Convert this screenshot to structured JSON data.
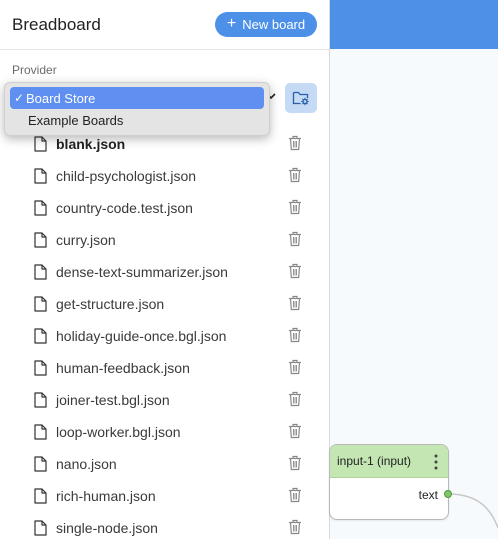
{
  "sidebar": {
    "title": "Breadboard",
    "new_board_label": "New board",
    "provider_label": "Provider",
    "provider_options": [
      {
        "label": "Board Store",
        "selected": true
      },
      {
        "label": "Example Boards",
        "selected": false
      }
    ],
    "files": [
      {
        "name": "blank.json",
        "active": true
      },
      {
        "name": "child-psychologist.json"
      },
      {
        "name": "country-code.test.json"
      },
      {
        "name": "curry.json"
      },
      {
        "name": "dense-text-summarizer.json"
      },
      {
        "name": "get-structure.json"
      },
      {
        "name": "holiday-guide-once.bgl.json"
      },
      {
        "name": "human-feedback.json"
      },
      {
        "name": "joiner-test.bgl.json"
      },
      {
        "name": "loop-worker.bgl.json"
      },
      {
        "name": "nano.json"
      },
      {
        "name": "rich-human.json"
      },
      {
        "name": "single-node.json"
      }
    ]
  },
  "node": {
    "title": "input-1 (input)",
    "port_label": "text"
  },
  "colors": {
    "accent": "#4d90e8",
    "node_header": "#c4e6b3",
    "selected_option": "#5f8ff1"
  }
}
